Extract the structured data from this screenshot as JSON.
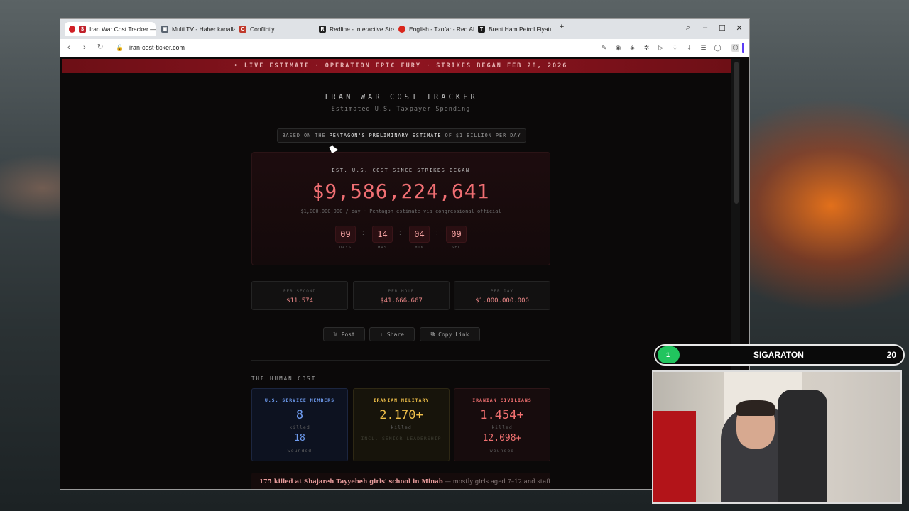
{
  "browser": {
    "tabs": [
      {
        "label": "Iran War Cost Tracker — U",
        "color": "#c0202a",
        "glyph": "$"
      },
      {
        "label": "Multi TV - Haber kanalları",
        "color": "#5a6470",
        "glyph": "▣"
      },
      {
        "label": "Conflictly",
        "color": "#c0392b",
        "glyph": "C"
      },
      {
        "label": "Redline - Interactive Strat",
        "color": "#222222",
        "glyph": "R"
      },
      {
        "label": "English - Tzofar - Red Aler",
        "color": "#d9261c",
        "glyph": "●"
      },
      {
        "label": "Brent Ham Petrol Fiyatı —",
        "color": "#1a1a1a",
        "glyph": "T"
      }
    ],
    "new_tab": "+",
    "url": "iran-cost-ticker.com"
  },
  "banner": {
    "text": "• LIVE ESTIMATE · OPERATION EPIC FURY · STRIKES BEGAN FEB 28, 2026"
  },
  "header": {
    "title": "IRAN WAR COST TRACKER",
    "subtitle": "Estimated U.S. Taxpayer Spending"
  },
  "basis": {
    "prefix": "BASED ON THE",
    "link": "PENTAGON'S PRELIMINARY ESTIMATE",
    "suffix": "OF $1 BILLION PER DAY"
  },
  "cost": {
    "label": "EST. U.S. COST SINCE STRIKES BEGAN",
    "value": "$9,586,224,641",
    "note": "$1,000,000,000 / day · Pentagon estimate via congressional official",
    "timer": [
      {
        "value": "09",
        "label": "DAYS"
      },
      {
        "value": "14",
        "label": "HRS"
      },
      {
        "value": "04",
        "label": "MIN"
      },
      {
        "value": "09",
        "label": "SEC"
      }
    ]
  },
  "rates": [
    {
      "label": "PER SECOND",
      "value": "$11.574"
    },
    {
      "label": "PER HOUR",
      "value": "$41.666.667"
    },
    {
      "label": "PER DAY",
      "value": "$1.000.000.000"
    }
  ],
  "share": {
    "post": "Post",
    "share": "Share",
    "copy": "Copy Link"
  },
  "human": {
    "header": "THE HUMAN COST",
    "cards": [
      {
        "title": "U.S. SERVICE MEMBERS",
        "n1": "8",
        "s1": "killed",
        "n2": "18",
        "s2": "wounded",
        "color": "#6f9cf0"
      },
      {
        "title": "IRANIAN MILITARY",
        "n1": "2.170+",
        "s1": "killed",
        "note": "INCL. SENIOR LEADERSHIP",
        "color": "#f0c04a"
      },
      {
        "title": "IRANIAN CIVILIANS",
        "n1": "1.454+",
        "s1": "killed",
        "n2": "12.098+",
        "s2": "wounded",
        "color": "#f07070"
      }
    ]
  },
  "minab": {
    "bold": "175 killed at Shajareh Tayyebeh girls' school in Minab",
    "rest": " — mostly girls aged 7–12 and staff."
  },
  "overlay": {
    "level": "1",
    "name": "SIGARATON",
    "count": "20"
  }
}
